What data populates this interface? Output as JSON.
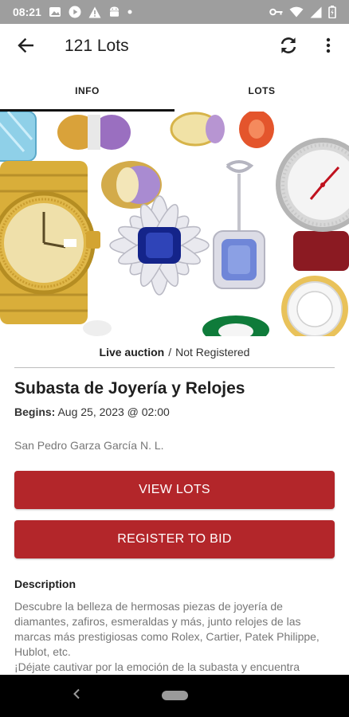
{
  "status_bar": {
    "time": "08:21",
    "left_icons": [
      "gallery-icon",
      "play-icon",
      "warning-icon",
      "android-icon",
      "dot-icon"
    ],
    "right_icons": [
      "key-icon",
      "wifi-icon",
      "signal-icon",
      "battery-icon"
    ]
  },
  "app_bar": {
    "back_icon": "arrow-back-icon",
    "title": "121 Lots",
    "refresh_icon": "refresh-icon",
    "more_icon": "more-vert-icon"
  },
  "tabs": [
    {
      "label": "INFO",
      "active": true
    },
    {
      "label": "LOTS",
      "active": false
    }
  ],
  "hero": {
    "alt": "jewelry-collage-image"
  },
  "auction": {
    "type": "Live auction",
    "separator": "/",
    "registration": "Not Registered",
    "title": "Subasta de Joyería y Relojes",
    "begins_label": "Begins:",
    "begins_value": "Aug 25, 2023 @ 02:00",
    "location": "San Pedro Garza García N. L."
  },
  "buttons": {
    "view_lots": "VIEW LOTS",
    "register": "REGISTER TO BID"
  },
  "description": {
    "heading": "Description",
    "text": "Descubre la belleza de hermosas piezas de joyería de diamantes, zafiros, esmeraldas y más, junto relojes de las marcas más prestigiosas como Rolex, Cartier, Patek Philippe, Hublot, etc.\n¡Déjate cautivar por la emoción de la subasta y encuentra"
  },
  "colors": {
    "accent": "#b3262a",
    "status_bar": "#9e9e9e",
    "nav_bar": "#000000"
  }
}
